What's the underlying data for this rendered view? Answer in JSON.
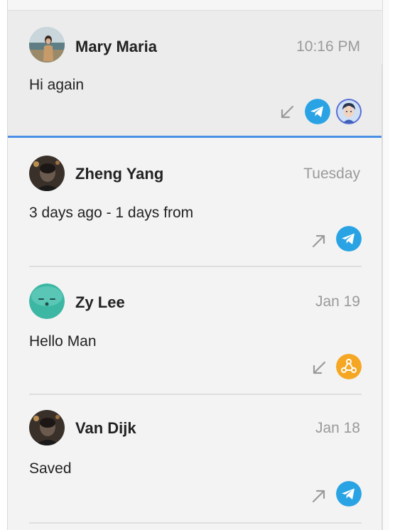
{
  "conversations": [
    {
      "name": "Mary Maria",
      "time": "10:16 PM",
      "message": "Hi again",
      "direction": "incoming",
      "channel": "telegram",
      "extra": "agent-avatar",
      "selected": true
    },
    {
      "name": "Zheng Yang",
      "time": "Tuesday",
      "message": "3 days ago - 1 days from",
      "direction": "outgoing",
      "channel": "telegram",
      "selected": false
    },
    {
      "name": "Zy Lee",
      "time": "Jan 19",
      "message": "Hello Man",
      "direction": "incoming",
      "channel": "webhook",
      "selected": false
    },
    {
      "name": "Van Dijk",
      "time": "Jan 18",
      "message": "Saved",
      "direction": "outgoing",
      "channel": "telegram",
      "selected": false
    }
  ],
  "colors": {
    "selection_bar": "#4a8fe7",
    "telegram": "#2aa3e4",
    "webhook": "#f5a623",
    "avatar_teal": "#3bb7a4"
  }
}
